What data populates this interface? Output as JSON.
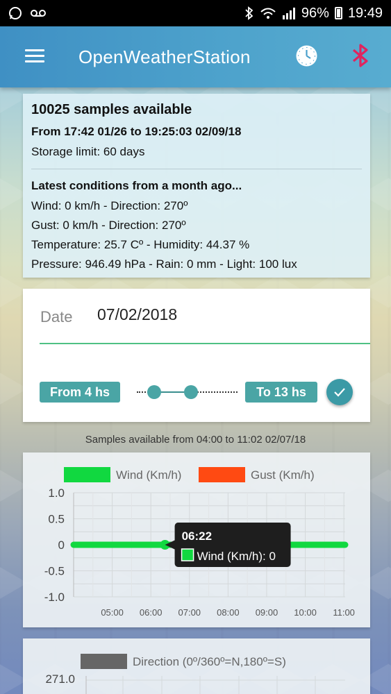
{
  "status_bar": {
    "battery": "96%",
    "time": "19:49",
    "icons": [
      "whatsapp-icon",
      "voicemail-icon",
      "bluetooth-icon",
      "wifi-icon",
      "signal-icon",
      "battery-icon"
    ]
  },
  "app_bar": {
    "title": "OpenWeatherStation",
    "icons": [
      "menu-icon",
      "clock-icon",
      "bluetooth-icon"
    ],
    "colors": {
      "bar": "#4a9fcb",
      "bluetooth": "#e0245e"
    }
  },
  "info_card": {
    "samples": "10025 samples available",
    "range": "From 17:42 01/26 to 19:25:03 02/09/18",
    "storage": "Storage limit: 60 days",
    "latest_title": "Latest conditions from a month ago...",
    "lines": [
      "Wind: 0 km/h - Direction: 270º",
      "Gust: 0 km/h - Direction: 270º",
      "Temperature: 25.7 Cº - Humidity: 44.37 %",
      "Pressure: 946.49 hPa - Rain: 0 mm - Light: 100 lux"
    ]
  },
  "date_card": {
    "label": "Date",
    "value": "07/02/2018",
    "from_label": "From 4 hs",
    "to_label": "To 13 hs",
    "range": {
      "min": 0,
      "max": 23,
      "from": 4,
      "to": 13
    },
    "accent": "#4aa5a5"
  },
  "samples_note": "Samples available from 04:00 to 11:02 02/07/18",
  "chart_data": [
    {
      "type": "line",
      "legend": [
        {
          "name": "Wind (Km/h)",
          "color": "#11d840"
        },
        {
          "name": "Gust (Km/h)",
          "color": "#ff4a12"
        }
      ],
      "y_ticks": [
        "1.0",
        "0.5",
        "0",
        "-0.5",
        "-1.0"
      ],
      "ylim": [
        -1.0,
        1.0
      ],
      "x_ticks": [
        "05:00",
        "06:00",
        "07:00",
        "08:00",
        "09:00",
        "10:00",
        "11:00"
      ],
      "xlim": [
        "04:00",
        "11:02"
      ],
      "series": [
        {
          "name": "Wind (Km/h)",
          "x": [
            "04:00",
            "11:02"
          ],
          "values": [
            0,
            0
          ]
        }
      ],
      "tooltip": {
        "time": "06:22",
        "label": "Wind (Km/h): 0"
      },
      "grid": true
    },
    {
      "type": "line",
      "legend": [
        {
          "name": "Direction (0º/360º=N,180º=S)",
          "color": "#666666"
        }
      ],
      "y_ticks": [
        "271.0"
      ],
      "grid": true
    }
  ]
}
